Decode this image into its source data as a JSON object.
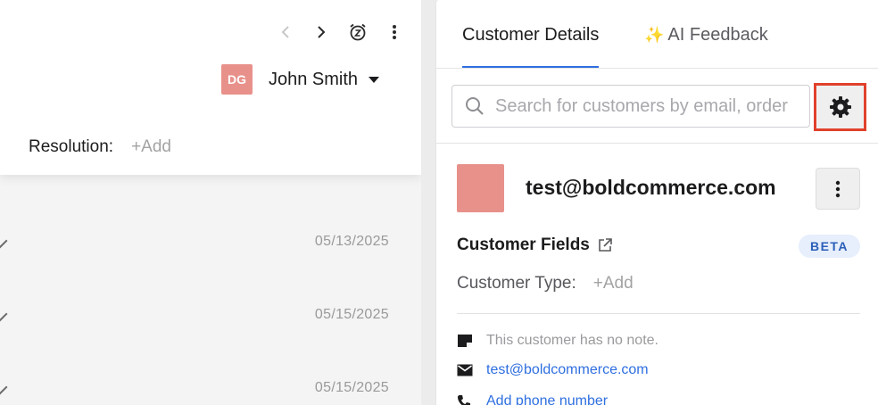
{
  "ticket_header": {
    "assignee": {
      "initials": "DG",
      "name": "John Smith"
    },
    "resolution_label": "Resolution:",
    "resolution_add": "+Add"
  },
  "history": [
    {
      "date": "05/13/2025"
    },
    {
      "date": "05/15/2025"
    },
    {
      "date": "05/15/2025"
    }
  ],
  "right_panel": {
    "tabs": [
      {
        "label": "Customer Details",
        "active": true
      },
      {
        "label": "AI Feedback",
        "icon": "✨",
        "active": false
      }
    ],
    "search": {
      "placeholder": "Search for customers by email, order"
    },
    "customer": {
      "email_title": "test@boldcommerce.com",
      "fields_title": "Customer Fields",
      "beta_badge": "BETA",
      "customer_type_label": "Customer Type:",
      "customer_type_add": "+Add",
      "note": "This customer has no note.",
      "email": "test@boldcommerce.com",
      "phone_action": "Add phone number"
    }
  },
  "colors": {
    "avatar": "#e8918b",
    "accent_blue": "#2f6fe0",
    "highlight_red": "#e0412c",
    "beta_bg": "#e7eefc"
  }
}
